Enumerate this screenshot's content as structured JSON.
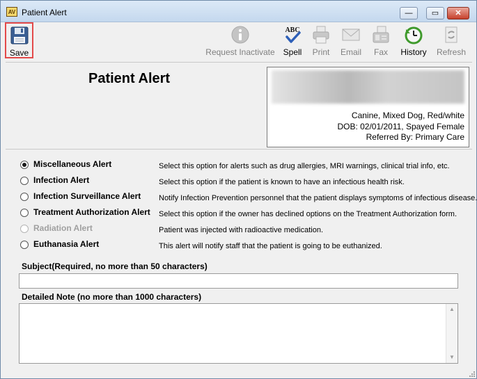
{
  "window": {
    "title": "Patient Alert",
    "app_icon_text": "AV",
    "controls": {
      "minimize": "—",
      "maximize": "▭",
      "close": "✕"
    }
  },
  "toolbar": {
    "save": "Save",
    "request_inactivate": "Request Inactivate",
    "spell": "Spell",
    "spell_icon_text": "ABC",
    "print": "Print",
    "email": "Email",
    "fax": "Fax",
    "history": "History",
    "refresh": "Refresh"
  },
  "heading": "Patient Alert",
  "patient": {
    "species_line": "Canine, Mixed Dog, Red/white",
    "dob_line": "DOB: 02/01/2011, Spayed Female",
    "referred_line": "Referred By: Primary Care"
  },
  "alert_types": [
    {
      "label": "Miscellaneous Alert",
      "description": "Select this option for alerts such as drug allergies, MRI warnings, clinical trial info, etc.",
      "selected": true,
      "enabled": true
    },
    {
      "label": "Infection Alert",
      "description": "Select this option if the patient is known to have an infectious health risk.",
      "selected": false,
      "enabled": true
    },
    {
      "label": "Infection Surveillance Alert",
      "description": "Notify Infection Prevention personnel that the patient displays symptoms of infectious disease.",
      "selected": false,
      "enabled": true
    },
    {
      "label": "Treatment Authorization Alert",
      "description": "Select this option if the owner has declined options on the Treatment Authorization form.",
      "selected": false,
      "enabled": true
    },
    {
      "label": "Radiation Alert",
      "description": "Patient was injected with radioactive medication.",
      "selected": false,
      "enabled": false
    },
    {
      "label": "Euthanasia Alert",
      "description": "This alert will notify staff that the patient is going to be euthanized.",
      "selected": false,
      "enabled": true
    }
  ],
  "subject": {
    "label": "Subject(Required, no more than 50 characters)",
    "value": ""
  },
  "note": {
    "label": "Detailed Note (no more than 1000 characters)",
    "value": ""
  },
  "colors": {
    "save_highlight": "#e34a4a",
    "titlebar": "#c4d8ee",
    "close_button": "#c7402c",
    "history_green": "#3f9a2c"
  }
}
